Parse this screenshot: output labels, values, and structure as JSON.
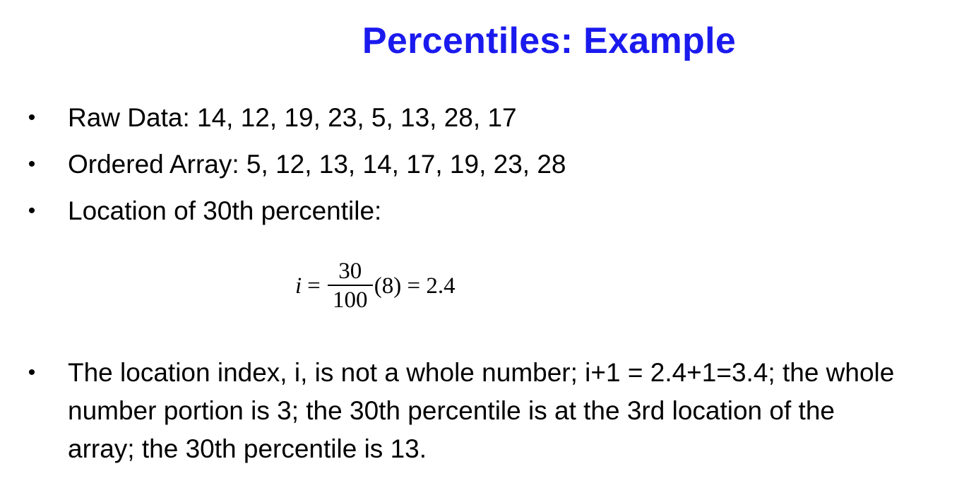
{
  "title": "Percentiles: Example",
  "bullets": [
    {
      "text": "Raw Data:  14, 12, 19, 23, 5, 13, 28, 17"
    },
    {
      "text": "Ordered Array:  5, 12, 13, 14, 17, 19, 23, 28"
    },
    {
      "text": "Location of  30th percentile:"
    },
    {
      "text": "The location index, i, is not a whole number; i+1 = 2.4+1=3.4; the whole number portion is 3; the 30th percentile is at the 3rd location of the array; the 30th percentile is 13."
    }
  ],
  "bullet_symbol": "•",
  "formula": {
    "variable": "i",
    "equals": "=",
    "numerator": "30",
    "denominator": "100",
    "rest": "(8) = 2.4"
  }
}
